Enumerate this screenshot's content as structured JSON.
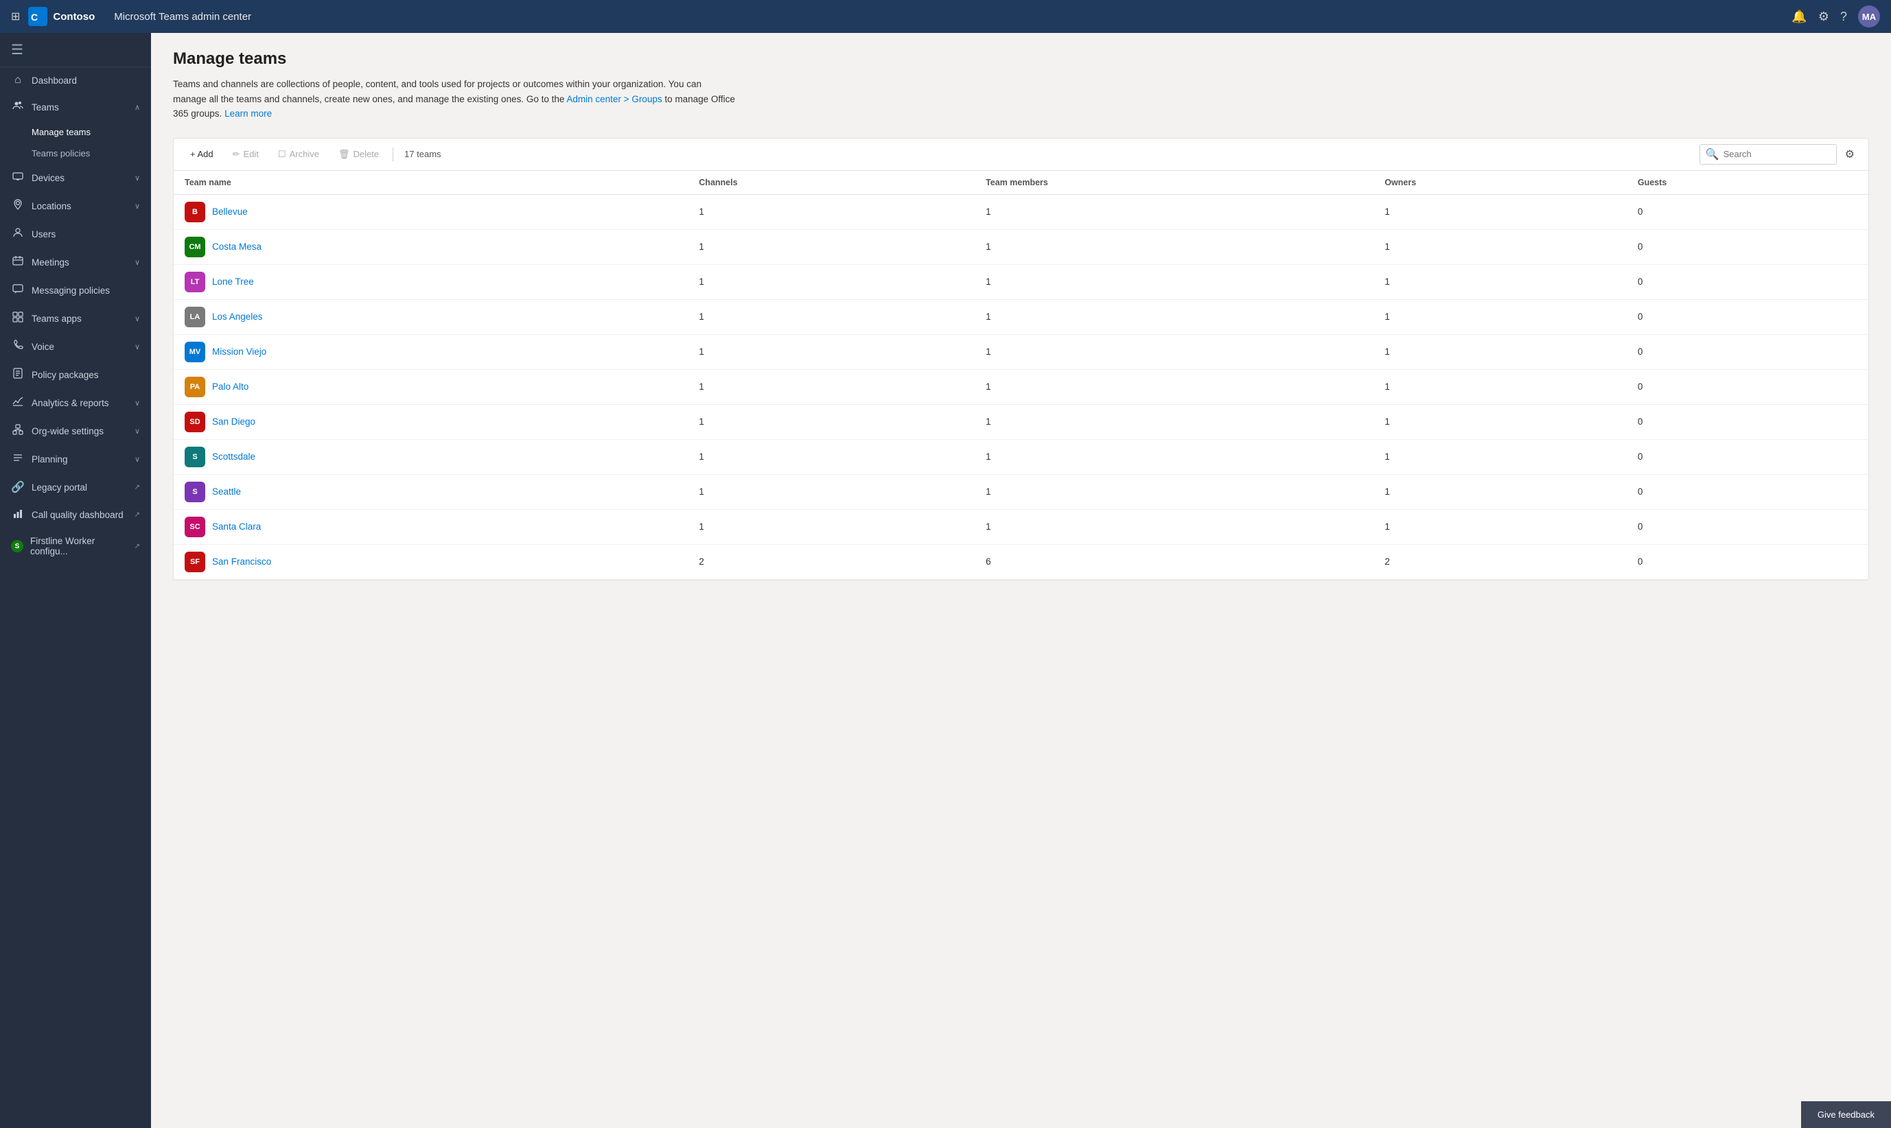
{
  "topbar": {
    "app_name": "Contoso",
    "title": "Microsoft Teams admin center",
    "avatar_initials": "MA"
  },
  "sidebar": {
    "menu_icon": "☰",
    "items": [
      {
        "id": "dashboard",
        "icon": "⌂",
        "label": "Dashboard",
        "has_sub": false
      },
      {
        "id": "teams",
        "icon": "👥",
        "label": "Teams",
        "has_sub": true,
        "expanded": true,
        "sub_items": [
          {
            "id": "manage-teams",
            "label": "Manage teams",
            "active": true
          },
          {
            "id": "teams-policies",
            "label": "Teams policies"
          }
        ]
      },
      {
        "id": "devices",
        "icon": "🖥",
        "label": "Devices",
        "has_sub": true
      },
      {
        "id": "locations",
        "icon": "📍",
        "label": "Locations",
        "has_sub": true
      },
      {
        "id": "users",
        "icon": "👤",
        "label": "Users",
        "has_sub": false
      },
      {
        "id": "meetings",
        "icon": "📅",
        "label": "Meetings",
        "has_sub": true
      },
      {
        "id": "messaging-policies",
        "icon": "💬",
        "label": "Messaging policies",
        "has_sub": false
      },
      {
        "id": "teams-apps",
        "icon": "⚙",
        "label": "Teams apps",
        "has_sub": true
      },
      {
        "id": "voice",
        "icon": "📞",
        "label": "Voice",
        "has_sub": true
      },
      {
        "id": "policy-packages",
        "icon": "📦",
        "label": "Policy packages",
        "has_sub": false
      },
      {
        "id": "analytics-reports",
        "icon": "📊",
        "label": "Analytics & reports",
        "has_sub": true
      },
      {
        "id": "org-wide-settings",
        "icon": "🏢",
        "label": "Org-wide settings",
        "has_sub": true
      },
      {
        "id": "planning",
        "icon": "📋",
        "label": "Planning",
        "has_sub": true
      },
      {
        "id": "legacy-portal",
        "icon": "🔗",
        "label": "Legacy portal",
        "external": true
      },
      {
        "id": "call-quality",
        "icon": "📈",
        "label": "Call quality dashboard",
        "external": true
      },
      {
        "id": "firstline-worker",
        "icon": "S",
        "label": "Firstline Worker configu...",
        "external": true
      }
    ]
  },
  "page": {
    "title": "Manage teams",
    "description": "Teams and channels are collections of people, content, and tools used for projects or outcomes within your organization. You can manage all the teams and channels, create new ones, and manage the existing ones. Go to the",
    "description_link1": "Admin center > Groups",
    "description_mid": "to manage Office 365 groups.",
    "description_link2": "Learn more"
  },
  "toolbar": {
    "add_label": "+ Add",
    "edit_label": "✏ Edit",
    "archive_label": "Archive",
    "delete_label": "Delete",
    "team_count": "17 teams",
    "search_placeholder": "Search"
  },
  "table": {
    "columns": [
      "Team name",
      "Channels",
      "Team members",
      "Owners",
      "Guests"
    ],
    "rows": [
      {
        "initials": "B",
        "color": "#c40f0f",
        "name": "Bellevue",
        "channels": 1,
        "members": 1,
        "owners": 1,
        "guests": 0
      },
      {
        "initials": "CM",
        "color": "#0e7a0e",
        "name": "Costa Mesa",
        "channels": 1,
        "members": 1,
        "owners": 1,
        "guests": 0
      },
      {
        "initials": "LT",
        "color": "#b535b5",
        "name": "Lone Tree",
        "channels": 1,
        "members": 1,
        "owners": 1,
        "guests": 0
      },
      {
        "initials": "LA",
        "color": "#7a7a7a",
        "name": "Los Angeles",
        "channels": 1,
        "members": 1,
        "owners": 1,
        "guests": 0
      },
      {
        "initials": "MV",
        "color": "#0078d4",
        "name": "Mission Viejo",
        "channels": 1,
        "members": 1,
        "owners": 1,
        "guests": 0
      },
      {
        "initials": "PA",
        "color": "#d4820a",
        "name": "Palo Alto",
        "channels": 1,
        "members": 1,
        "owners": 1,
        "guests": 0
      },
      {
        "initials": "SD",
        "color": "#c40f0f",
        "name": "San Diego",
        "channels": 1,
        "members": 1,
        "owners": 1,
        "guests": 0
      },
      {
        "initials": "S",
        "color": "#0e7a7a",
        "name": "Scottsdale",
        "channels": 1,
        "members": 1,
        "owners": 1,
        "guests": 0
      },
      {
        "initials": "S",
        "color": "#7a35b5",
        "name": "Seattle",
        "channels": 1,
        "members": 1,
        "owners": 1,
        "guests": 0
      },
      {
        "initials": "SC",
        "color": "#c40f6a",
        "name": "Santa Clara",
        "channels": 1,
        "members": 1,
        "owners": 1,
        "guests": 0
      },
      {
        "initials": "SF",
        "color": "#c40f0f",
        "name": "San Francisco",
        "channels": 2,
        "members": 6,
        "owners": 2,
        "guests": 0
      }
    ]
  },
  "feedback": {
    "label": "Give feedback"
  }
}
